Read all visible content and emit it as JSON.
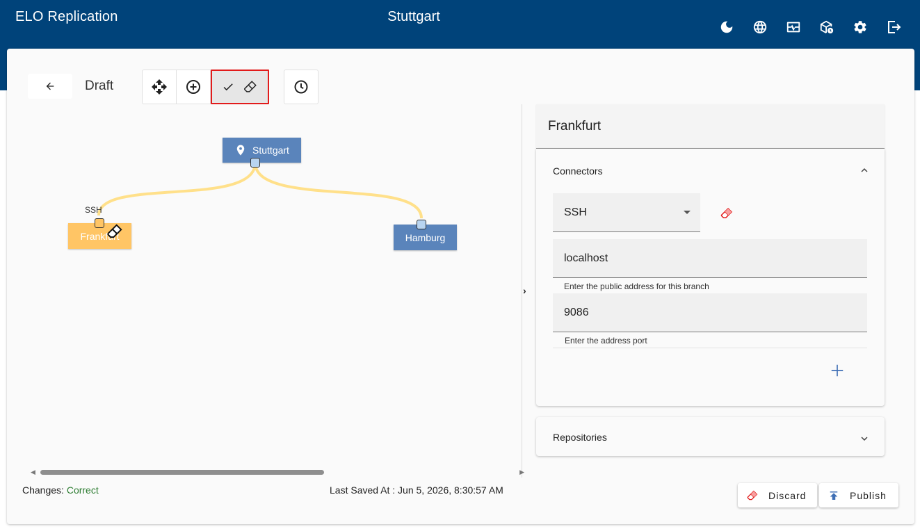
{
  "header": {
    "app_title": "ELO Replication",
    "center_title": "Stuttgart",
    "icons": [
      "dark-mode-icon",
      "globe-icon",
      "monitor-heart-icon",
      "package-clock-icon",
      "gear-icon",
      "logout-icon"
    ]
  },
  "toolbar": {
    "status_label": "Draft",
    "tools": [
      "move-icon",
      "add-circle-icon",
      "check-icon",
      "eraser-icon",
      "history-icon"
    ]
  },
  "graph": {
    "nodes": [
      {
        "id": "stuttgart",
        "label": "Stuttgart",
        "color": "#5a84bb"
      },
      {
        "id": "frankfurt",
        "label": "Frankfurt",
        "color": "#ffc565"
      },
      {
        "id": "hamburg",
        "label": "Hamburg",
        "color": "#5a84bb"
      }
    ],
    "edge_label": "SSH",
    "edge_color": "#ffe08a"
  },
  "status": {
    "changes_label": "Changes:",
    "changes_value": "Correct",
    "last_saved": "Last Saved At : Jun 5, 2026, 8:30:57 AM"
  },
  "panel": {
    "title": "Frankfurt",
    "connectors_title": "Connectors",
    "connector_type": "SSH",
    "address_value": "localhost",
    "address_hint": "Enter the public address for this branch",
    "port_value": "9086",
    "port_hint": "Enter the address port",
    "repositories_title": "Repositories"
  },
  "actions": {
    "discard_label": "Discard",
    "publish_label": "Publish"
  },
  "colors": {
    "header_bg": "#00437a",
    "accent": "#3f6fb5",
    "danger": "#e21b1b",
    "success": "#2e7d32"
  }
}
